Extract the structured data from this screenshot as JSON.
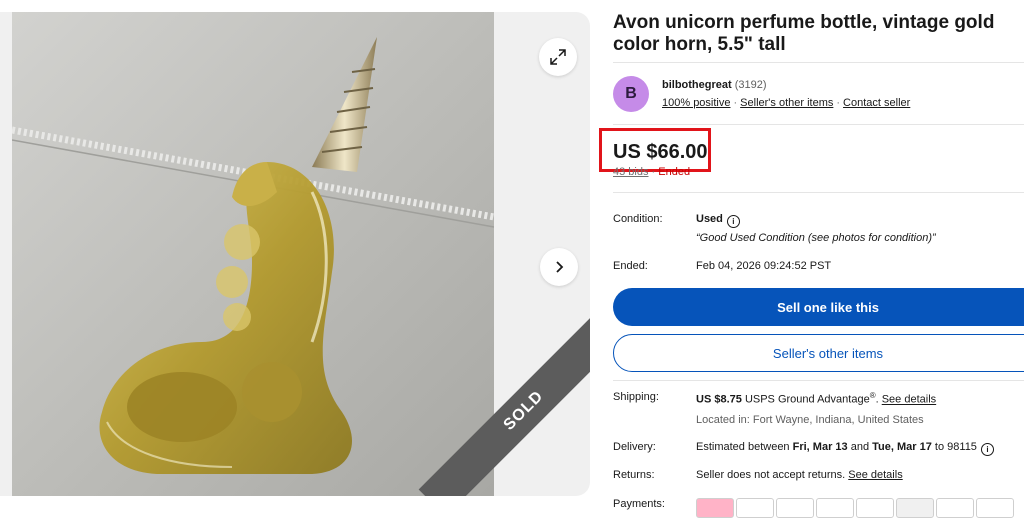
{
  "listing": {
    "title": "Avon unicorn perfume bottle, vintage gold color horn, 5.5\" tall",
    "sold_label": "SOLD"
  },
  "seller": {
    "avatar_letter": "B",
    "name": "bilbothegreat",
    "feedback_count": "(3192)",
    "positive": "100% positive",
    "other_items": "Seller's other items",
    "contact": "Contact seller"
  },
  "price": {
    "value": "US $66.00",
    "bids": "43 bids",
    "status": "Ended"
  },
  "details": {
    "condition_label": "Condition:",
    "condition_value": "Used",
    "condition_note": "“Good Used Condition (see photos for condition)”",
    "ended_label": "Ended:",
    "ended_value": "Feb 04, 2026 09:24:52 PST"
  },
  "actions": {
    "sell_one": "Sell one like this",
    "other_items": "Seller's other items"
  },
  "shipping": {
    "label": "Shipping:",
    "cost": "US $8.75",
    "service": "USPS Ground Advantage",
    "reg": "®",
    "see_details": "See details",
    "location": "Located in: Fort Wayne, Indiana, United States"
  },
  "delivery": {
    "label": "Delivery:",
    "prefix": "Estimated between",
    "start": "Fri, Mar 13",
    "and": "and",
    "end": "Tue, Mar 17",
    "to": "to 98115"
  },
  "returns": {
    "label": "Returns:",
    "text": "Seller does not accept returns.",
    "see_details": "See details"
  },
  "payments": {
    "label": "Payments:",
    "methods": [
      "klarna",
      "paypal",
      "venmo",
      "gpay",
      "visa",
      "mastercard",
      "discover",
      "diners"
    ]
  },
  "colors": {
    "primary_blue": "#0654ba",
    "highlight_red": "#e1141a",
    "avatar_purple": "#c58be8",
    "ended_red": "#c70000"
  },
  "icons": {
    "expand": "expand-icon",
    "next": "chevron-right-icon",
    "info": "info-icon"
  }
}
